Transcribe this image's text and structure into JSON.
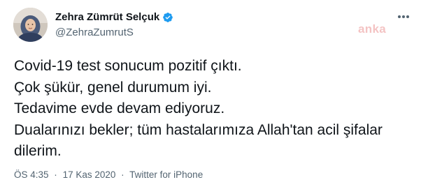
{
  "tweet": {
    "author": {
      "display_name": "Zehra Zümrüt Selçuk",
      "handle": "@ZehraZumrutS",
      "verified": true,
      "avatar_icon": "profile-photo"
    },
    "text_lines": [
      "Covid-19 test sonucum pozitif çıktı.",
      "Çok şükür, genel durumum iyi.",
      "Tedavime evde devam ediyoruz.",
      "Dualarınızı bekler; tüm hastalarımıza Allah'tan acil şifalar",
      "dilerim."
    ],
    "meta": {
      "time": "ÖS 4:35",
      "separator": "·",
      "date": "17 Kas 2020",
      "source": "Twitter for iPhone"
    },
    "more_icon": "more-options-icon"
  },
  "watermark": {
    "text": "anka"
  },
  "colors": {
    "text_primary": "#0f1419",
    "text_secondary": "#536471",
    "verified_blue": "#1d9bf0",
    "watermark_red": "#d62828"
  }
}
